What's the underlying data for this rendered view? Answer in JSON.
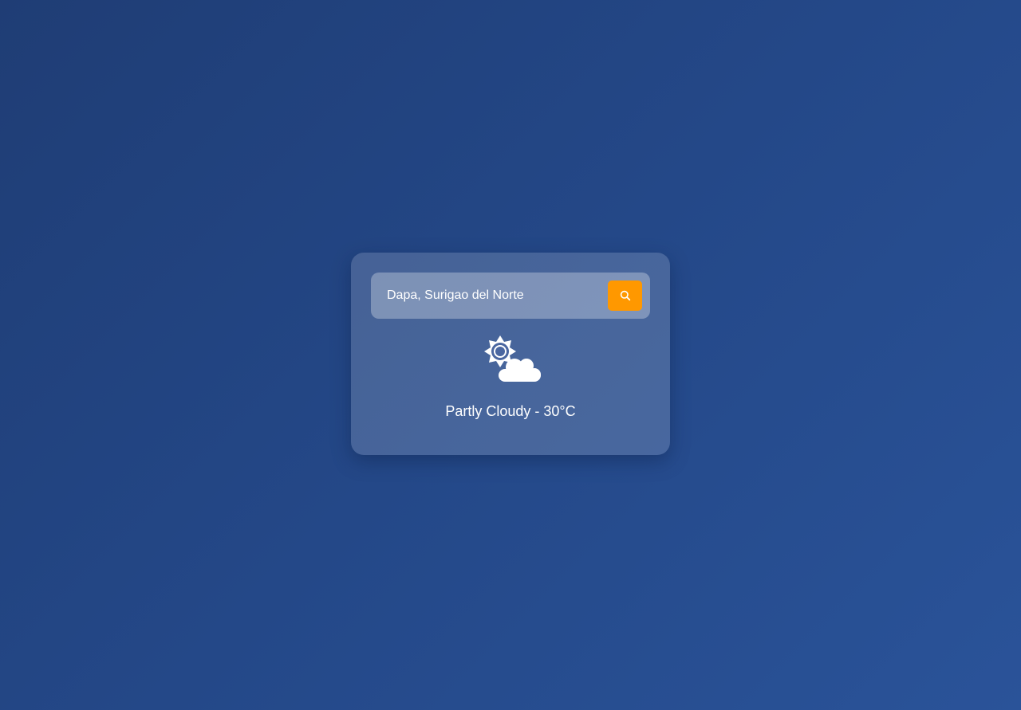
{
  "search": {
    "value": "Dapa, Surigao del Norte",
    "button_icon": "search-icon",
    "button_color": "#ff9800"
  },
  "weather": {
    "icon": "partly-cloudy-icon",
    "description": "Partly Cloudy - 30°C"
  }
}
